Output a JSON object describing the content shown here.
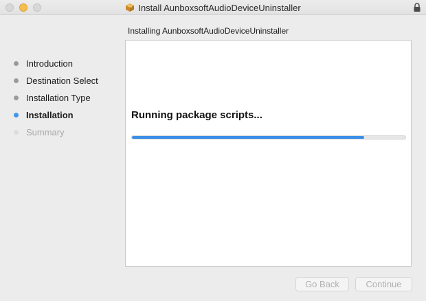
{
  "window": {
    "title": "Install AunboxsoftAudioDeviceUninstaller"
  },
  "header": {
    "subtitle": "Installing AunboxsoftAudioDeviceUninstaller"
  },
  "sidebar": {
    "steps": [
      {
        "label": "Introduction",
        "state": "done"
      },
      {
        "label": "Destination Select",
        "state": "done"
      },
      {
        "label": "Installation Type",
        "state": "done"
      },
      {
        "label": "Installation",
        "state": "active"
      },
      {
        "label": "Summary",
        "state": "pending"
      }
    ]
  },
  "main": {
    "status": "Running package scripts...",
    "progress_percent": 85
  },
  "buttons": {
    "back_label": "Go Back",
    "continue_label": "Continue"
  },
  "colors": {
    "accent": "#3b8ee6",
    "active_dot": "#3f97e6"
  },
  "icons": {
    "title_icon": "package-icon",
    "lock_icon": "lock-icon"
  }
}
